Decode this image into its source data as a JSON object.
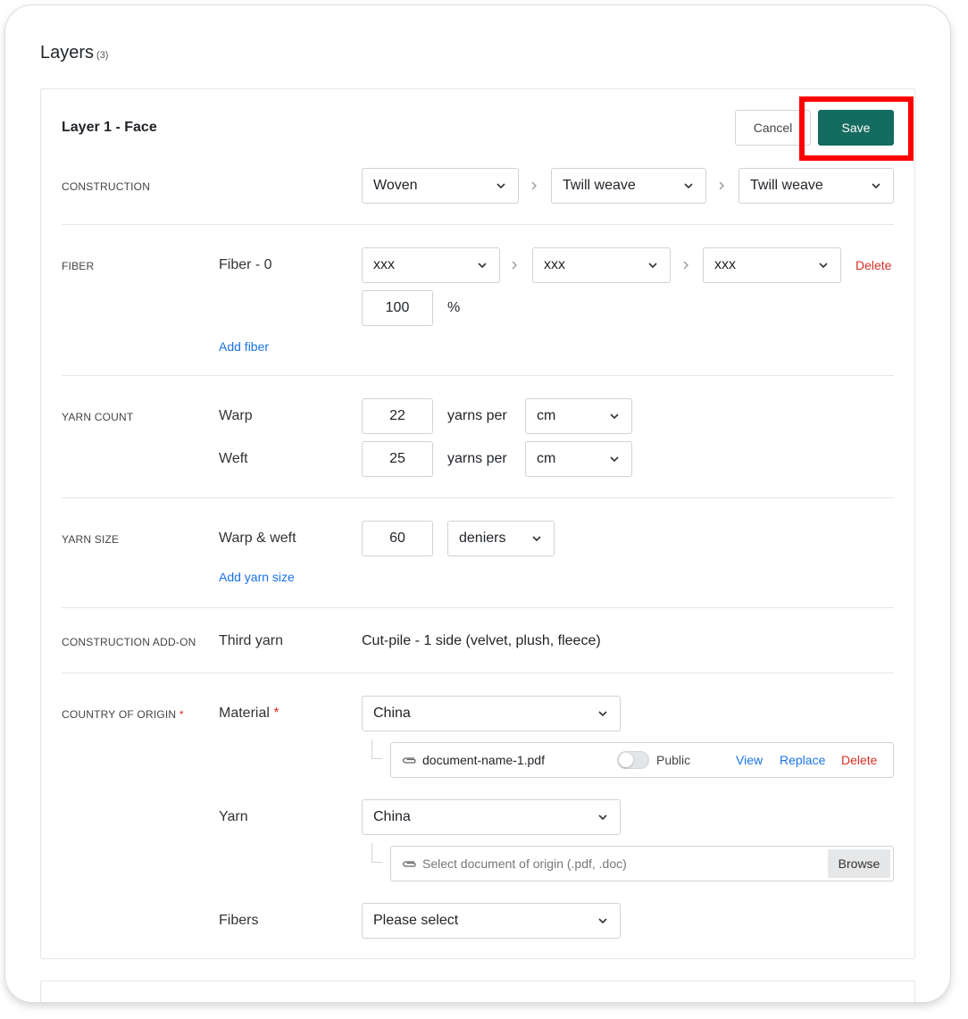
{
  "page": {
    "title": "Layers",
    "count": "(3)"
  },
  "layer": {
    "title": "Layer 1 - Face",
    "cancel_label": "Cancel",
    "save_label": "Save",
    "construction": {
      "label": "CONSTRUCTION",
      "selects": [
        "Woven",
        "Twill weave",
        "Twill weave"
      ]
    },
    "fiber": {
      "label": "FIBER",
      "row_label": "Fiber - 0",
      "selects": [
        "xxx",
        "xxx",
        "xxx"
      ],
      "delete_label": "Delete",
      "percent_value": "100",
      "percent_unit": "%",
      "add_label": "Add fiber"
    },
    "yarn_count": {
      "label": "YARN COUNT",
      "rows": [
        {
          "label": "Warp",
          "value": "22",
          "unit_text": "yarns per",
          "unit": "cm"
        },
        {
          "label": "Weft",
          "value": "25",
          "unit_text": "yarns per",
          "unit": "cm"
        }
      ]
    },
    "yarn_size": {
      "label": "YARN SIZE",
      "row_label": "Warp & weft",
      "value": "60",
      "unit": "deniers",
      "add_label": "Add yarn size"
    },
    "addon": {
      "label": "CONSTRUCTION ADD-ON",
      "row_label": "Third yarn",
      "value": "Cut-pile - 1 side (velvet, plush, fleece)"
    },
    "origin": {
      "label": "COUNTRY OF ORIGIN",
      "required_mark": "*",
      "material": {
        "label": "Material",
        "value": "China",
        "doc_name": "document-name-1.pdf",
        "public_label": "Public",
        "public_on": false,
        "view_label": "View",
        "replace_label": "Replace",
        "delete_label": "Delete"
      },
      "yarn": {
        "label": "Yarn",
        "value": "China",
        "doc_placeholder": "Select document of origin (.pdf, .doc)",
        "browse_label": "Browse"
      },
      "fibers": {
        "label": "Fibers",
        "value": "Please select"
      }
    }
  },
  "colors": {
    "primary": "#146b5f",
    "link": "#1a73e8",
    "danger": "#d93025",
    "highlight": "#ff0000"
  }
}
